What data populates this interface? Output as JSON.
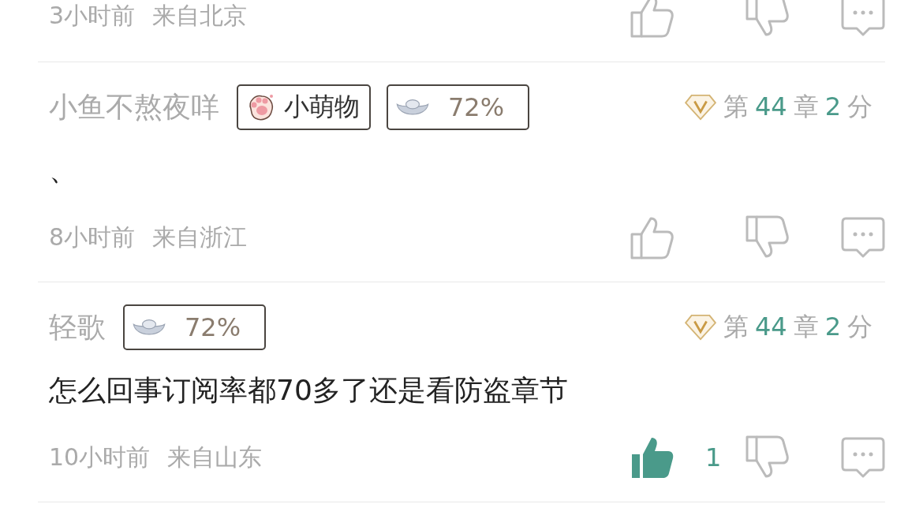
{
  "comments": [
    {
      "time": "3小时前",
      "location": "来自北京",
      "liked": false
    },
    {
      "name": "小鱼不熬夜咩",
      "badges": [
        {
          "kind": "fan",
          "label": "小萌物"
        },
        {
          "kind": "ingot",
          "label": "72%"
        }
      ],
      "chapter_info": [
        {
          "text": "第",
          "highlight": false
        },
        {
          "text": "44",
          "highlight": true
        },
        {
          "text": "章",
          "highlight": false
        },
        {
          "text": "2",
          "highlight": true
        },
        {
          "text": "分",
          "highlight": false
        }
      ],
      "body": "、",
      "time": "8小时前",
      "location": "来自浙江",
      "liked": false
    },
    {
      "name": "轻歌",
      "badges": [
        {
          "kind": "ingot",
          "label": "72%"
        }
      ],
      "chapter_info": [
        {
          "text": "第",
          "highlight": false
        },
        {
          "text": "44",
          "highlight": true
        },
        {
          "text": "章",
          "highlight": false
        },
        {
          "text": "2",
          "highlight": true
        },
        {
          "text": "分",
          "highlight": false
        }
      ],
      "body": "怎么回事订阅率都70多了还是看防盗章节",
      "time": "10小时前",
      "location": "来自山东",
      "liked": true,
      "like_count": "1"
    }
  ]
}
